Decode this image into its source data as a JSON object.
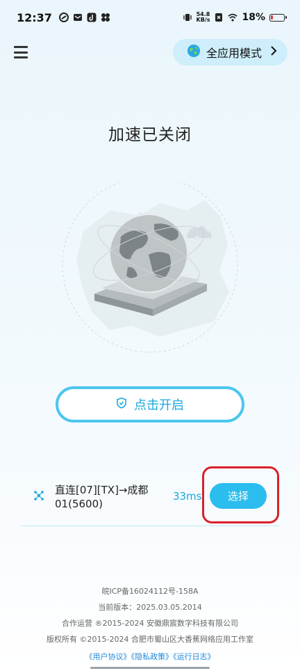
{
  "status_bar": {
    "time": "12:37",
    "net_speed_value": "54.8",
    "net_speed_unit": "KB/s",
    "battery_percent": "18%",
    "battery_level": 0.18
  },
  "header": {
    "menu_icon": "hamburger-menu-icon",
    "mode_button_label": "全应用模式",
    "mode_icon": "globe-icon"
  },
  "main": {
    "title": "加速已关闭",
    "start_button_label": "点击开启"
  },
  "server": {
    "name": "直连[07][TX]→成都01(5600)",
    "ping": "33ms",
    "select_label": "选择"
  },
  "footer": {
    "icp": "皖ICP备16024112号-158A",
    "version": "当前版本：2025.03.05.2014",
    "operator": "合作运营 ®2015-2024 安徽鼎宸数字科技有限公司",
    "copyright": "版权所有 ©2015-2024 合肥市蜀山区大香蕉网络应用工作室",
    "links": [
      "《用户协议》",
      "《隐私政策》",
      "《运行日志》"
    ]
  },
  "colors": {
    "accent": "#2bbdee",
    "accent_text": "#1aa8e0",
    "link": "#1e88d8",
    "highlight": "#d9202a"
  }
}
